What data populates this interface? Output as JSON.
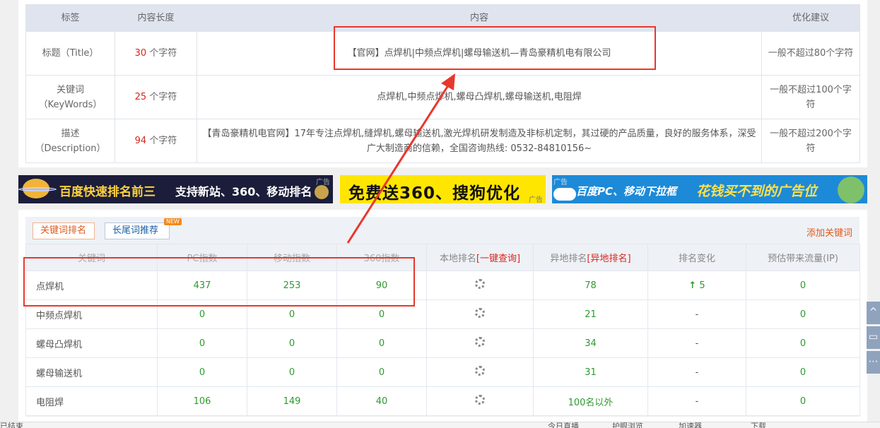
{
  "meta": {
    "headers": [
      "标签",
      "内容长度",
      "内容",
      "优化建议"
    ],
    "unit": "个字符",
    "rows": [
      {
        "label": "标题（Title）",
        "count": "30",
        "content": "【官网】点焊机|中频点焊机|螺母输送机—青岛豪精机电有限公司",
        "advice": "一般不超过80个字符"
      },
      {
        "label": "关键词（KeyWords）",
        "count": "25",
        "content": "点焊机,中频点焊机,螺母凸焊机,螺母输送机,电阻焊",
        "advice": "一般不超过100个字符"
      },
      {
        "label": "描述（Description）",
        "count": "94",
        "content": "【青岛豪精机电官网】17年专注点焊机,缝焊机,螺母输送机,激光焊机研发制造及非标机定制，其过硬的产品质量，良好的服务体系，深受广大制造商的信赖，全国咨询热线: 0532-84810156~",
        "advice": "一般不超过200个字符"
      }
    ]
  },
  "ads": {
    "tag": "广告",
    "ad1_main": "百度快速排名前三",
    "ad1_sub": "支持新站、360、移动排名",
    "ad2_main": "免费送360、搜狗优化",
    "ad3_main": "百度PC、移动下拉框",
    "ad3_sub": "花钱买不到的广告位"
  },
  "keywords": {
    "tab_active": "关键词排名",
    "tab_other": "长尾词推荐",
    "new_badge": "NEW",
    "add_link": "添加关键词",
    "headers": {
      "keyword": "关键词",
      "pc": "PC指数",
      "mobile": "移动指数",
      "s360": "360指数",
      "local": "本地排名",
      "local_link": "[一键查询]",
      "remote": "异地排名",
      "remote_link": "[异地排名]",
      "change": "排名变化",
      "traffic": "预估带来流量(IP)"
    },
    "rows": [
      {
        "keyword": "点焊机",
        "pc": "437",
        "mobile": "253",
        "s360": "90",
        "remote": "78",
        "change": "5",
        "traffic": "0"
      },
      {
        "keyword": "中频点焊机",
        "pc": "0",
        "mobile": "0",
        "s360": "0",
        "remote": "21",
        "change": "-",
        "traffic": "0"
      },
      {
        "keyword": "螺母凸焊机",
        "pc": "0",
        "mobile": "0",
        "s360": "0",
        "remote": "34",
        "change": "-",
        "traffic": "0"
      },
      {
        "keyword": "螺母输送机",
        "pc": "0",
        "mobile": "0",
        "s360": "0",
        "remote": "31",
        "change": "-",
        "traffic": "0"
      },
      {
        "keyword": "电阻焊",
        "pc": "106",
        "mobile": "149",
        "s360": "40",
        "remote": "100名以外",
        "change": "-",
        "traffic": "0"
      }
    ]
  },
  "status": {
    "left": "已结束",
    "items": [
      "今日直播",
      "护眼浏览",
      "加速器",
      "下载"
    ]
  },
  "colors": {
    "accent_red": "#e8372c",
    "green": "#2e9a2e",
    "orange": "#e05a1c"
  }
}
